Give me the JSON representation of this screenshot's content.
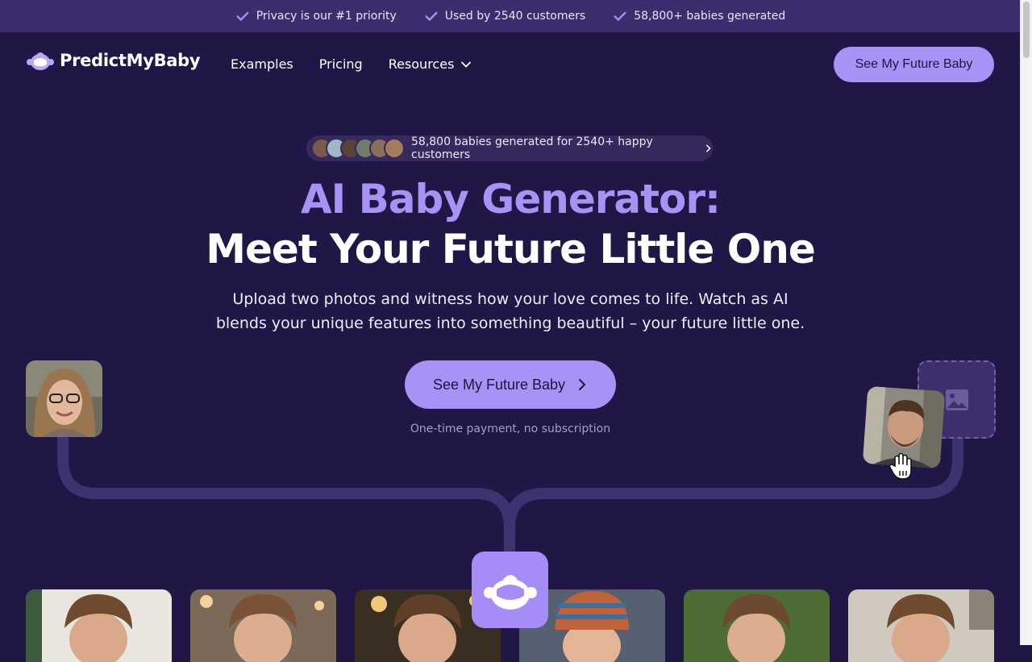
{
  "topbar": {
    "items": [
      "Privacy is our #1 priority",
      "Used by 2540 customers",
      "58,800+ babies generated"
    ],
    "icon": "check-icon",
    "color": "#3e2d6e"
  },
  "header": {
    "logo_text": "PredictMyBaby",
    "nav": [
      "Examples",
      "Pricing",
      "Resources"
    ],
    "cta_label": "See My Future Baby"
  },
  "hero": {
    "pill_text": "58,800 babies generated for 2540+ happy customers",
    "title_line1": "AI Baby Generator:",
    "title_line2": "Meet Your Future Little One",
    "subtitle": "Upload two photos and witness how your love comes to life. Watch as AI blends your unique features into something beautiful – your future little one.",
    "cta_label": "See My Future Baby",
    "note": "One-time payment, no subscription"
  },
  "colors": {
    "background": "#211747",
    "accent": "#a992f5",
    "connector": "#3f3270"
  },
  "icons": {
    "upload": "image-icon",
    "hand": "hand-cursor-icon",
    "badge": "baby-icon"
  }
}
